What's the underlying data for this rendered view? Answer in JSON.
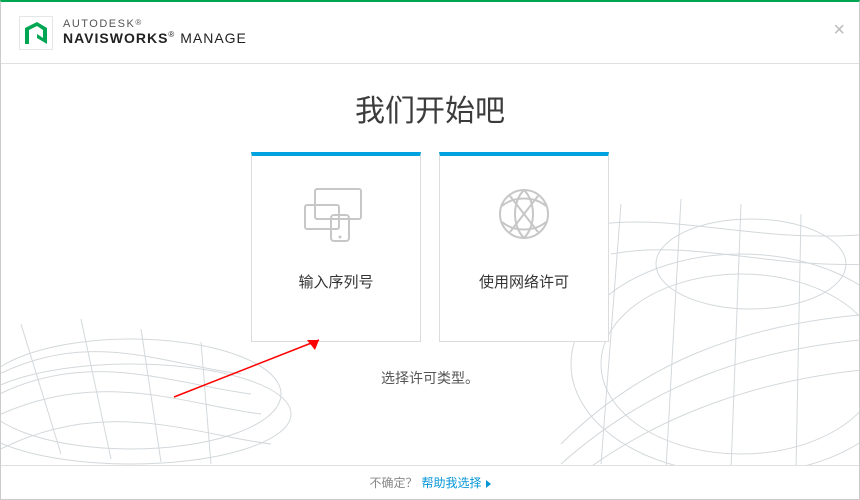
{
  "brand": {
    "top": "AUTODESK",
    "bottom_bold": "NAVISWORKS",
    "bottom_light": "MANAGE",
    "logo_color": "#00a651"
  },
  "title": "我们开始吧",
  "cards": [
    {
      "label": "输入序列号"
    },
    {
      "label": "使用网络许可"
    }
  ],
  "subtitle": "选择许可类型。",
  "footer": {
    "muted": "不确定？",
    "link": "帮助我选择"
  },
  "accent_top": "#00a651",
  "accent_card": "#00a3e0"
}
